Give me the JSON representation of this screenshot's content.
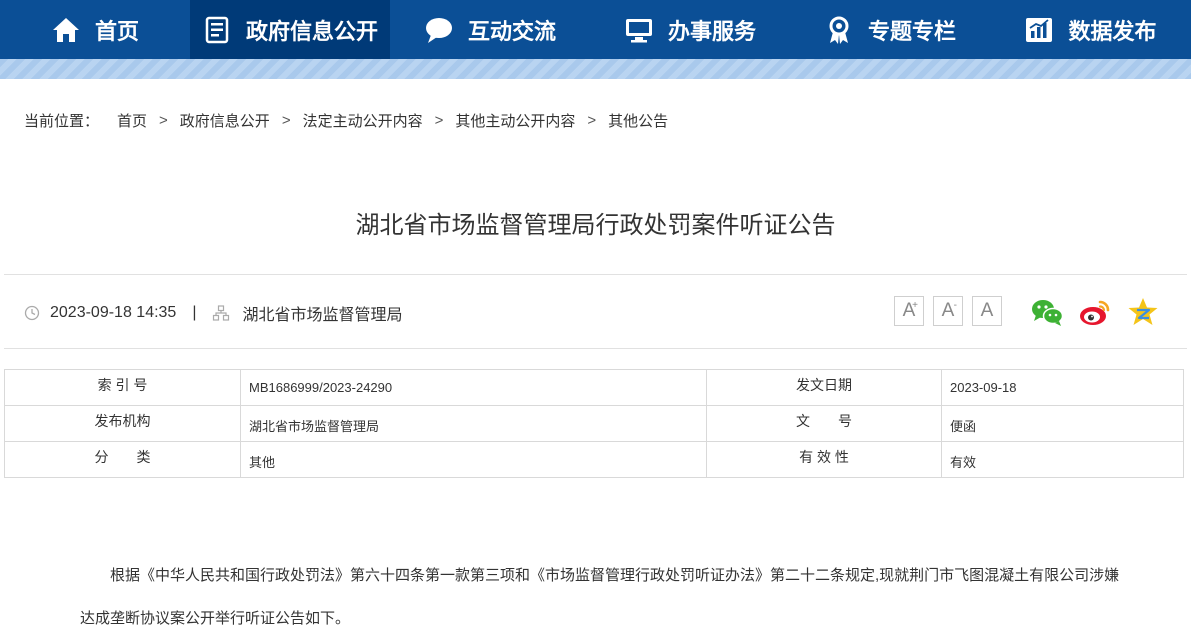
{
  "nav": {
    "items": [
      {
        "label": "首页",
        "icon": "home-icon"
      },
      {
        "label": "政府信息公开",
        "icon": "document-list-icon"
      },
      {
        "label": "互动交流",
        "icon": "chat-bubble-icon"
      },
      {
        "label": "办事服务",
        "icon": "monitor-icon"
      },
      {
        "label": "专题专栏",
        "icon": "award-icon"
      },
      {
        "label": "数据发布",
        "icon": "bar-chart-icon"
      }
    ],
    "active_index": 1,
    "colors": {
      "bar": "#0b4f96",
      "active": "#003a78"
    }
  },
  "breadcrumb": {
    "label": "当前位置：",
    "items": [
      "首页",
      "政府信息公开",
      "法定主动公开内容",
      "其他主动公开内容",
      "其他公告"
    ],
    "separator": ">"
  },
  "article": {
    "title": "湖北省市场监督管理局行政处罚案件听证公告",
    "datetime": "2023-09-18 14:35",
    "divider": "|",
    "source": "湖北省市场监督管理局",
    "body": "根据《中华人民共和国行政处罚法》第六十四条第一款第三项和《市场监督管理行政处罚听证办法》第二十二条规定,现就荆门市飞图混凝土有限公司涉嫌达成垄断协议案公开举行听证公告如下。"
  },
  "font_controls": {
    "increase": "A",
    "increase_mark": "+",
    "decrease": "A",
    "decrease_mark": "-",
    "reset": "A"
  },
  "share": {
    "icons": [
      "wechat-icon",
      "weibo-icon",
      "qzone-icon"
    ]
  },
  "info_table": {
    "rows": [
      {
        "k1": "索 引 号",
        "v1": "MB1686999/2023-24290",
        "k2": "发文日期",
        "v2": "2023-09-18"
      },
      {
        "k1": "发布机构",
        "v1": "湖北省市场监督管理局",
        "k2": "文　　号",
        "v2": "便函"
      },
      {
        "k1": "分　　类",
        "v1": "其他",
        "k2": "有 效 性",
        "v2": "有效"
      }
    ]
  }
}
